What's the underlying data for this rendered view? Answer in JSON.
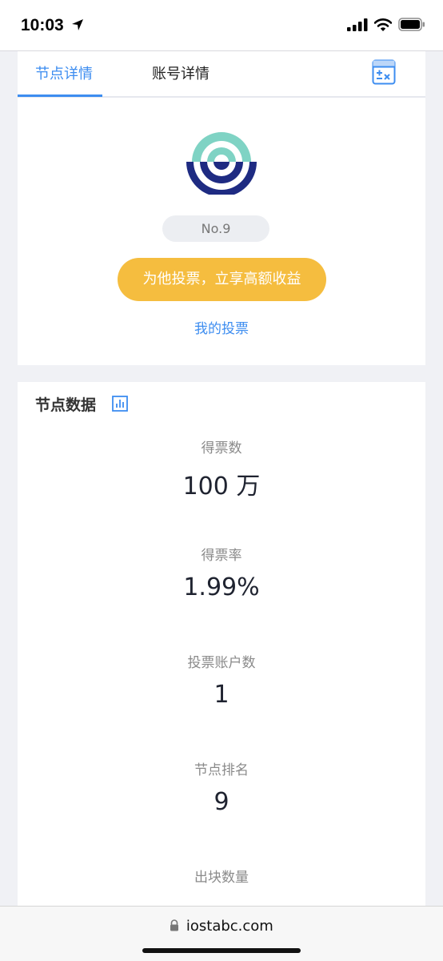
{
  "status_bar": {
    "time": "10:03"
  },
  "tabs": [
    {
      "label": "节点详情",
      "active": true
    },
    {
      "label": "账号详情",
      "active": false
    }
  ],
  "node": {
    "rank_label": "No.9",
    "vote_button": "为他投票，立享高额收益",
    "my_votes_link": "我的投票"
  },
  "node_data": {
    "title": "节点数据",
    "stats": [
      {
        "label": "得票数",
        "value": "100 万"
      },
      {
        "label": "得票率",
        "value": "1.99%"
      },
      {
        "label": "投票账户数",
        "value": "1"
      },
      {
        "label": "节点排名",
        "value": "9"
      },
      {
        "label": "出块数量",
        "value": ""
      }
    ]
  },
  "browser": {
    "url": "iostabc.com"
  },
  "colors": {
    "accent": "#3d8df0",
    "vote_button": "#f5bd3f",
    "logo_teal": "#7fd3c4",
    "logo_navy": "#1e2b82"
  },
  "icons": [
    "location-arrow-icon",
    "signal-icon",
    "wifi-icon",
    "battery-icon",
    "calculator-icon",
    "bar-chart-icon",
    "lock-icon"
  ]
}
